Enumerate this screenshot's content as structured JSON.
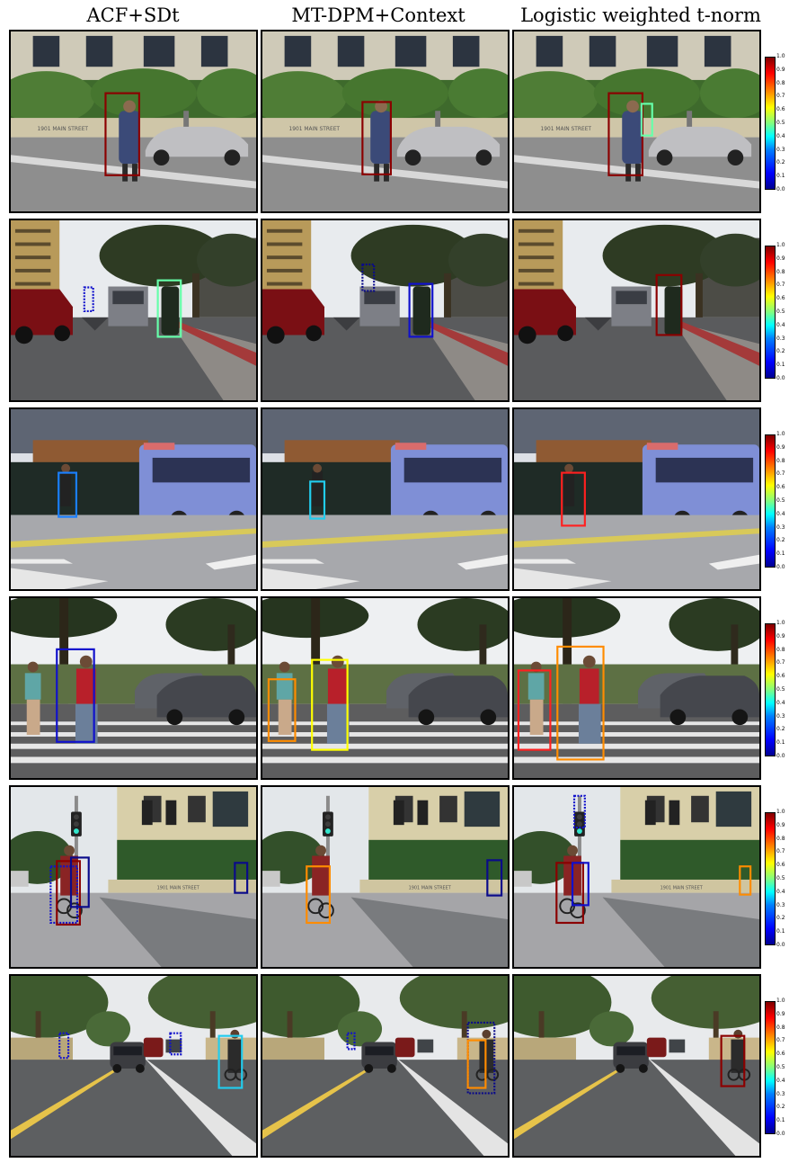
{
  "columns": [
    "ACF+SDt",
    "MT-DPM+Context",
    "Logistic weighted t-norm"
  ],
  "colorbar_ticks": [
    "1.0",
    "0.9",
    "0.8",
    "0.7",
    "0.6",
    "0.5",
    "0.4",
    "0.3",
    "0.2",
    "0.1",
    "0.0"
  ],
  "street_sign": "1901 MAIN STREET",
  "colors": {
    "dark_red": "#8b0000",
    "red": "#ff2020",
    "orange": "#ff8c00",
    "yellow": "#ffff00",
    "mint": "#66ffaa",
    "cyan": "#22ccee",
    "light_blue": "#1a7fff",
    "blue": "#1010cc",
    "navy": "#0a0a8a"
  }
}
